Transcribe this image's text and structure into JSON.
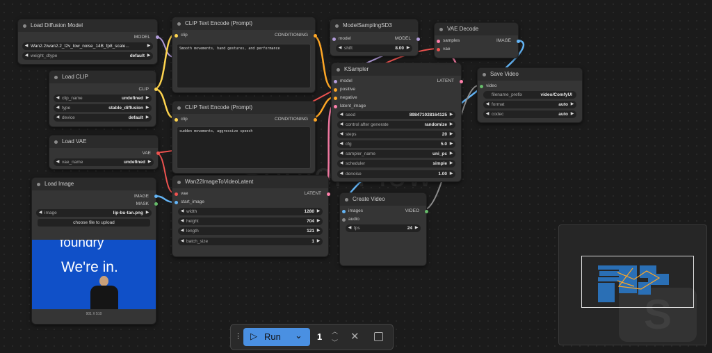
{
  "colors": {
    "model": "#b39ddb",
    "clip": "#ffd54f",
    "conditioning": "#ffa726",
    "latent": "#ff80ab",
    "vae": "#ef5350",
    "image": "#64b5f6",
    "video": "#66bb6a",
    "run": "#4a90e2"
  },
  "watermark": "Server Flow",
  "nodes": {
    "load_diffusion": {
      "title": "Load Diffusion Model",
      "out_model": "MODEL",
      "unet_name": "Wan2.2/wan2.2_t2v_low_noise_14B_fp8_scale...",
      "weight_dtype_label": "weight_dtype",
      "weight_dtype": "default"
    },
    "load_clip": {
      "title": "Load CLIP",
      "out_clip": "CLIP",
      "clip_name_label": "clip_name",
      "clip_name": "undefined",
      "type_label": "type",
      "type": "stable_diffusion",
      "device_label": "device",
      "device": "default"
    },
    "clip_pos": {
      "title": "CLIP Text Encode (Prompt)",
      "in_clip": "clip",
      "out_cond": "CONDITIONING",
      "text": "Smooth movements, hand gestures, and performance"
    },
    "clip_neg": {
      "title": "CLIP Text Encode (Prompt)",
      "in_clip": "clip",
      "out_cond": "CONDITIONING",
      "text": "sudden movements, aggressive speech"
    },
    "load_vae": {
      "title": "Load VAE",
      "out_vae": "VAE",
      "vae_name_label": "vae_name",
      "vae_name": "undefined"
    },
    "load_image": {
      "title": "Load Image",
      "out_image": "IMAGE",
      "out_mask": "MASK",
      "image_label": "image",
      "image": "lip-bu-tan.png",
      "upload": "choose file to upload",
      "preview_top": "foundry",
      "preview_main": "We're in.",
      "dims": "901 X 510"
    },
    "model_sampling": {
      "title": "ModelSamplingSD3",
      "in_model": "model",
      "out_model": "MODEL",
      "shift_label": "shift",
      "shift": "8.00"
    },
    "ksampler": {
      "title": "KSampler",
      "in_model": "model",
      "in_positive": "positive",
      "in_negative": "negative",
      "in_latent": "latent_image",
      "out_latent": "LATENT",
      "widgets": [
        {
          "label": "seed",
          "value": "898471028164125"
        },
        {
          "label": "control after generate",
          "value": "randomize"
        },
        {
          "label": "steps",
          "value": "20"
        },
        {
          "label": "cfg",
          "value": "5.0"
        },
        {
          "label": "sampler_name",
          "value": "uni_pc"
        },
        {
          "label": "scheduler",
          "value": "simple"
        },
        {
          "label": "denoise",
          "value": "1.00"
        }
      ]
    },
    "wan_latent": {
      "title": "Wan22ImageToVideoLatent",
      "in_vae": "vae",
      "in_start": "start_image",
      "out_latent": "LATENT",
      "widgets": [
        {
          "label": "width",
          "value": "1280"
        },
        {
          "label": "height",
          "value": "704"
        },
        {
          "label": "length",
          "value": "121"
        },
        {
          "label": "batch_size",
          "value": "1"
        }
      ]
    },
    "vae_decode": {
      "title": "VAE Decode",
      "in_samples": "samples",
      "in_vae": "vae",
      "out_image": "IMAGE"
    },
    "save_video": {
      "title": "Save Video",
      "in_video": "video",
      "prefix_label": "filename_prefix",
      "prefix": "video/ComfyUI",
      "format_label": "format",
      "format": "auto",
      "codec_label": "codec",
      "codec": "auto"
    },
    "create_video": {
      "title": "Create Video",
      "in_images": "images",
      "in_audio": "audio",
      "out_video": "VIDEO",
      "fps_label": "fps",
      "fps": "24"
    }
  },
  "toolbar": {
    "run_label": "Run",
    "queue_count": "1"
  }
}
